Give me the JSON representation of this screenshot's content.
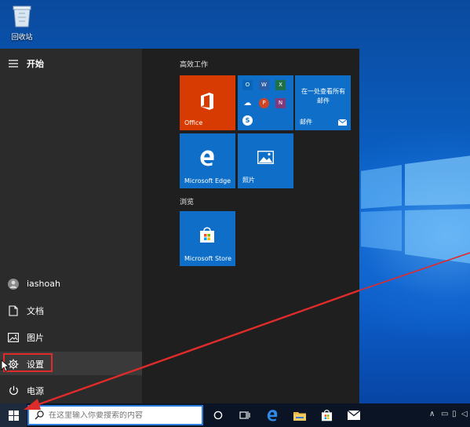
{
  "desktop": {
    "recycle_bin_label": "回收站"
  },
  "start_menu": {
    "header_label": "开始",
    "user_name": "iashoah",
    "nav": {
      "documents": "文档",
      "pictures": "图片",
      "settings": "设置",
      "power": "电源"
    },
    "groups": {
      "productivity": "高效工作",
      "explore": "浏览"
    },
    "tiles": {
      "office": "Office",
      "mail_promo": "在一处查看所有邮件",
      "mail": "邮件",
      "edge": "Microsoft Edge",
      "photos": "照片",
      "store": "Microsoft Store"
    }
  },
  "taskbar": {
    "search_placeholder": "在这里输入你要搜索的内容"
  },
  "colors": {
    "tile_blue": "#0f6fc8",
    "office_orange": "#d83b01",
    "highlight_red": "#e02b2b",
    "arrow_red": "#e02b2b"
  }
}
